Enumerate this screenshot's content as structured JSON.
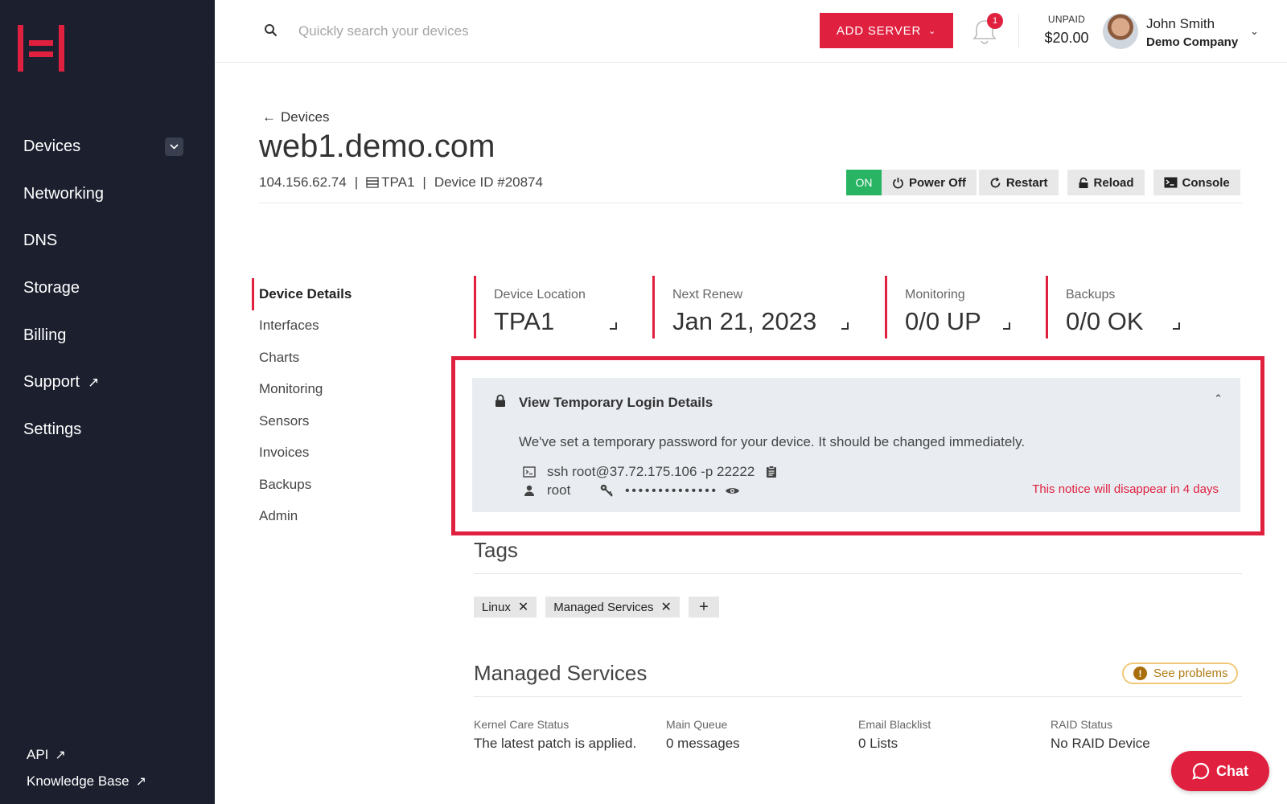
{
  "brand": {
    "accent": "#e0203f",
    "sidebar_bg": "#1b1f2e",
    "on_green": "#28b463"
  },
  "sidebar": {
    "items": [
      {
        "label": "Devices",
        "has_dropdown": true,
        "external": false
      },
      {
        "label": "Networking",
        "external": false
      },
      {
        "label": "DNS",
        "external": false
      },
      {
        "label": "Storage",
        "external": false
      },
      {
        "label": "Billing",
        "external": false
      },
      {
        "label": "Support",
        "external": true
      },
      {
        "label": "Settings",
        "external": false
      }
    ],
    "bottom_links": [
      {
        "label": "API"
      },
      {
        "label": "Knowledge Base"
      }
    ]
  },
  "header": {
    "search_placeholder": "Quickly search your devices",
    "add_server_label": "ADD SERVER",
    "notification_count": "1",
    "unpaid_label": "UNPAID",
    "unpaid_amount": "$20.00",
    "user_name": "John Smith",
    "user_company": "Demo Company"
  },
  "device": {
    "back_label": "Devices",
    "title": "web1.demo.com",
    "ip": "104.156.62.74",
    "location": "TPA1",
    "device_id": "Device ID #20874",
    "status": "ON",
    "actions": {
      "power_off": "Power Off",
      "restart": "Restart",
      "reload": "Reload",
      "console": "Console"
    }
  },
  "subnav": [
    {
      "label": "Device Details",
      "active": true
    },
    {
      "label": "Interfaces"
    },
    {
      "label": "Charts"
    },
    {
      "label": "Monitoring"
    },
    {
      "label": "Sensors"
    },
    {
      "label": "Invoices"
    },
    {
      "label": "Backups"
    },
    {
      "label": "Admin"
    }
  ],
  "stats": [
    {
      "label": "Device Location",
      "value": "TPA1"
    },
    {
      "label": "Next Renew",
      "value": "Jan 21, 2023"
    },
    {
      "label": "Monitoring",
      "value": "0/0 UP"
    },
    {
      "label": "Backups",
      "value": "0/0 OK"
    }
  ],
  "notice": {
    "title": "View Temporary Login Details",
    "message": "We've set a temporary password for your device. It should be changed immediately.",
    "ssh_command": "ssh root@37.72.175.106 -p 22222",
    "username": "root",
    "password_mask": "••••••••••••••",
    "expiry": "This notice will disappear in 4 days"
  },
  "tags": {
    "title": "Tags",
    "items": [
      "Linux",
      "Managed Services"
    ],
    "add_label": "+"
  },
  "managed_services": {
    "title": "Managed Services",
    "problems_label": "See problems",
    "columns": [
      {
        "label": "Kernel Care Status",
        "value": "The latest patch is applied."
      },
      {
        "label": "Main Queue",
        "value": "0 messages"
      },
      {
        "label": "Email Blacklist",
        "value": "0 Lists"
      },
      {
        "label": "RAID Status",
        "value": "No RAID Device"
      }
    ]
  },
  "chat_label": "Chat"
}
